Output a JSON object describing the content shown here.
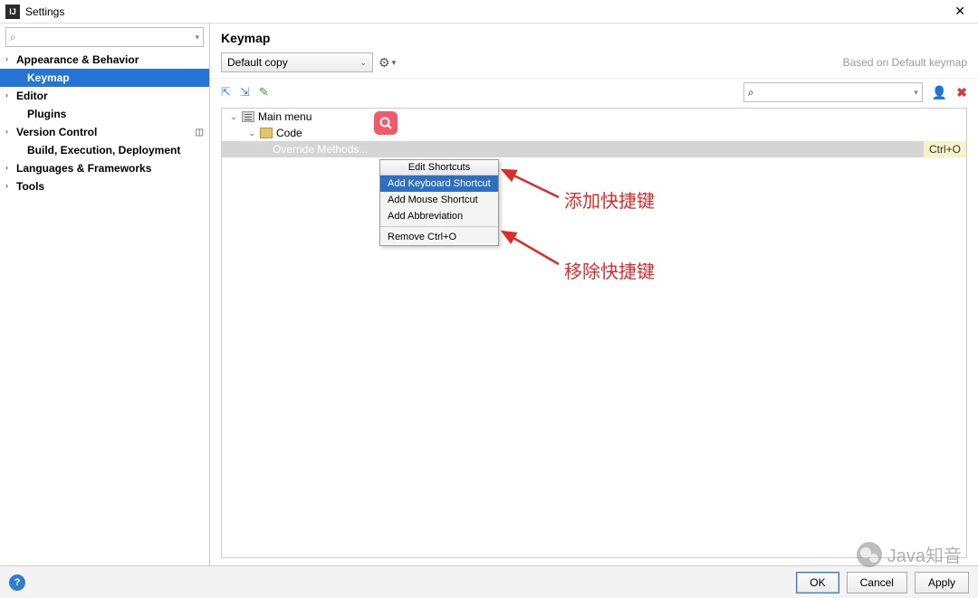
{
  "window": {
    "title": "Settings"
  },
  "sidebar": {
    "search_placeholder": "",
    "items": [
      {
        "label": "Appearance & Behavior",
        "expandable": true
      },
      {
        "label": "Keymap",
        "selected": true,
        "child": true
      },
      {
        "label": "Editor",
        "expandable": true
      },
      {
        "label": "Plugins",
        "child": true
      },
      {
        "label": "Version Control",
        "expandable": true,
        "badge": true
      },
      {
        "label": "Build, Execution, Deployment",
        "child": true
      },
      {
        "label": "Languages & Frameworks",
        "expandable": true
      },
      {
        "label": "Tools",
        "expandable": true
      }
    ]
  },
  "main": {
    "heading": "Keymap",
    "scheme": "Default copy",
    "based_on": "Based on Default keymap",
    "tree": {
      "root": "Main menu",
      "child": "Code",
      "selected_action": "Override Methods...",
      "selected_shortcut": "Ctrl+O"
    },
    "context_menu": {
      "title": "Edit Shortcuts",
      "items": [
        "Add Keyboard Shortcut",
        "Add Mouse Shortcut",
        "Add Abbreviation"
      ],
      "remove": "Remove Ctrl+O"
    },
    "annotations": {
      "add": "添加快捷键",
      "remove": "移除快捷键"
    }
  },
  "footer": {
    "ok": "OK",
    "cancel": "Cancel",
    "apply": "Apply"
  },
  "watermark": "Java知音"
}
